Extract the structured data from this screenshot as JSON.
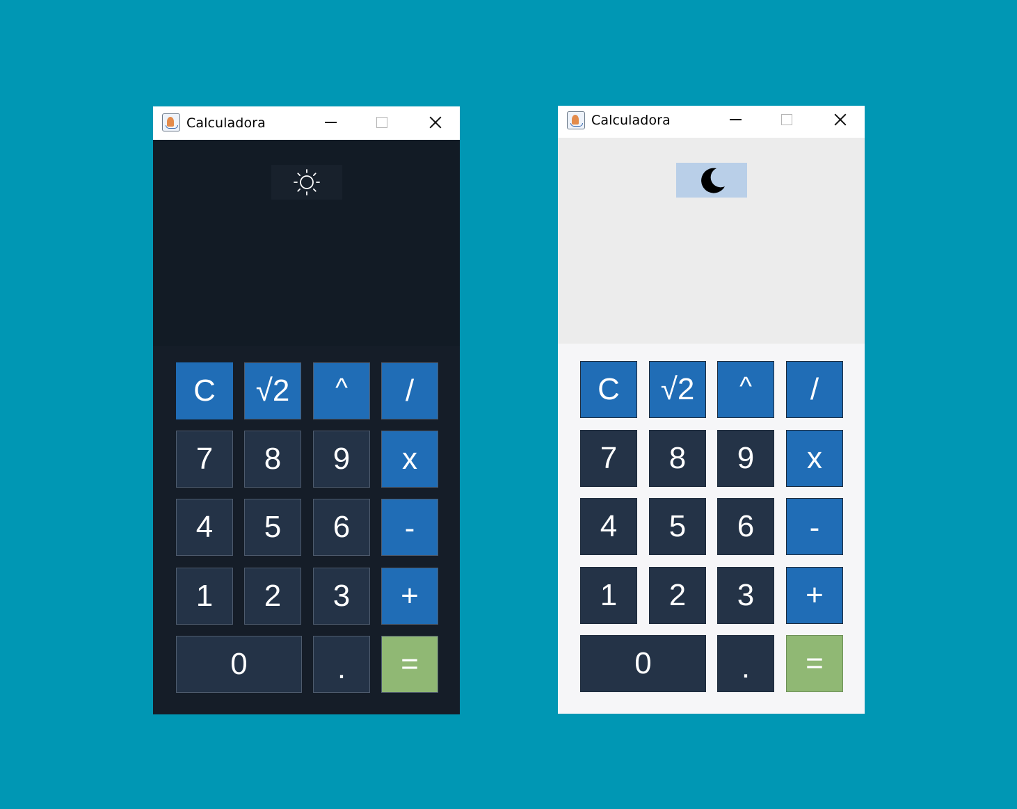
{
  "colors": {
    "desktop": "#0097b4",
    "dark_display": "#121b25",
    "dark_keypad": "#151d28",
    "light_display": "#ececec",
    "light_keypad": "#f6f6f8",
    "number_key": "#243347",
    "operator_key": "#206db6",
    "equals_key": "#90b874"
  },
  "windows": [
    {
      "theme": "dark",
      "title": "Calculadora",
      "theme_toggle_icon": "sun-icon",
      "display_value": "",
      "keys": [
        "C",
        "√2",
        "^",
        "/",
        "7",
        "8",
        "9",
        "x",
        "4",
        "5",
        "6",
        "-",
        "1",
        "2",
        "3",
        "+",
        "0",
        ".",
        "="
      ]
    },
    {
      "theme": "light",
      "title": "Calculadora",
      "theme_toggle_icon": "moon-icon",
      "display_value": "",
      "keys": [
        "C",
        "√2",
        "^",
        "/",
        "7",
        "8",
        "9",
        "x",
        "4",
        "5",
        "6",
        "-",
        "1",
        "2",
        "3",
        "+",
        "0",
        ".",
        "="
      ]
    }
  ]
}
